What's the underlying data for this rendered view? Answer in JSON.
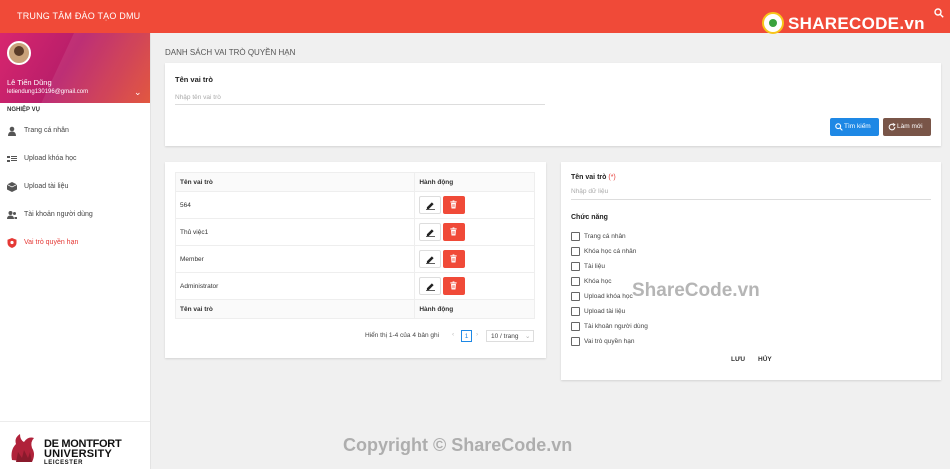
{
  "header": {
    "title": "TRUNG TÂM ĐÀO TẠO DMU",
    "logo_text": "SHARECODE.vn"
  },
  "sidebar": {
    "user_name": "Lê Tiến Dũng",
    "user_email": "letiendung130196@gmail.com",
    "section": "NGHIỆP VỤ",
    "items": [
      {
        "label": "Trang cá nhân",
        "icon": "person-icon"
      },
      {
        "label": "Upload khóa học",
        "icon": "course-icon"
      },
      {
        "label": "Upload tài liệu",
        "icon": "box-icon"
      },
      {
        "label": "Tài khoản người dùng",
        "icon": "users-icon"
      },
      {
        "label": "Vai trò quyền hạn",
        "icon": "shield-icon"
      }
    ],
    "logo": {
      "line1": "DE MONTFORT",
      "line2": "UNIVERSITY",
      "line3": "LEICESTER"
    }
  },
  "main": {
    "page_title": "DANH SÁCH VAI TRÒ QUYỀN HẠN",
    "search": {
      "label": "Tên vai trò",
      "placeholder": "Nhập tên vai trò",
      "search_button": "Tìm kiếm",
      "refresh_button": "Làm mới"
    },
    "table": {
      "headers": [
        "Tên vai trò",
        "Hành động"
      ],
      "rows": [
        "564",
        "Thủ việc1",
        "Member",
        "Administrator"
      ],
      "footer": [
        "Tên vai trò",
        "Hành động"
      ]
    },
    "pagination": {
      "summary": "Hiển thị 1-4 của 4 bản ghi",
      "current_page": "1",
      "page_size": "10 / trang"
    },
    "form": {
      "role_label": "Tên vai trò",
      "required_mark": "(*)",
      "role_placeholder": "Nhập dữ liệu",
      "functions_label": "Chức năng",
      "functions": [
        "Trang cá nhân",
        "Khóa học cá nhân",
        "Tài liệu",
        "Khóa học",
        "Upload khóa học",
        "Upload tài liệu",
        "Tài khoản người dùng",
        "Vai trò quyền hạn"
      ],
      "save_label": "LƯU",
      "cancel_label": "HỦY"
    }
  },
  "watermarks": {
    "center": "ShareCode.vn",
    "bottom": "Copyright © ShareCode.vn"
  },
  "colors": {
    "header": "#f04a38",
    "primary": "#1e88e5",
    "refresh": "#795548",
    "delete": "#f04a38",
    "active": "#e53935"
  }
}
